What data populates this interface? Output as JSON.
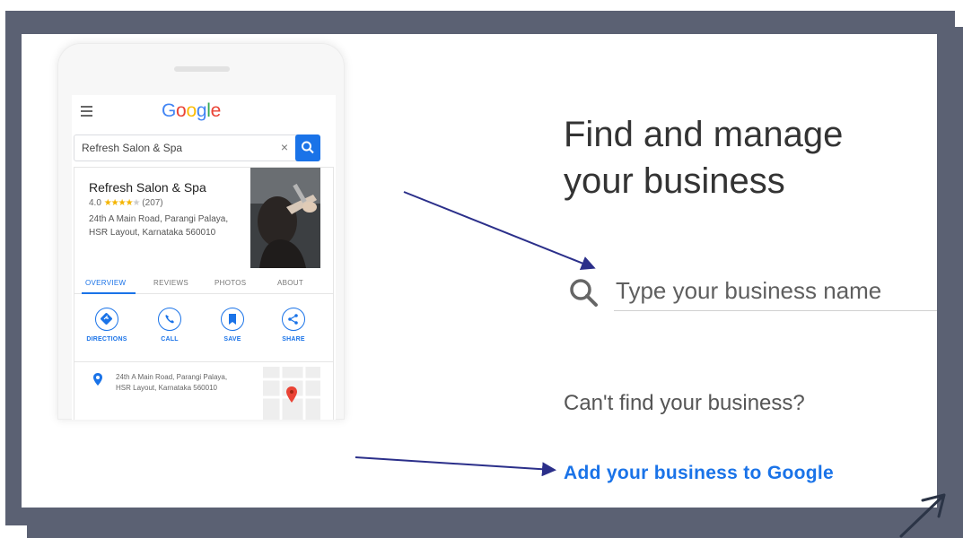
{
  "phone": {
    "google_logo": [
      {
        "ch": "G",
        "color": "#4285F4"
      },
      {
        "ch": "o",
        "color": "#EA4335"
      },
      {
        "ch": "o",
        "color": "#FBBC05"
      },
      {
        "ch": "g",
        "color": "#4285F4"
      },
      {
        "ch": "l",
        "color": "#34A853"
      },
      {
        "ch": "e",
        "color": "#EA4335"
      }
    ],
    "search_query": "Refresh Salon & Spa",
    "clear_glyph": "×",
    "business": {
      "name": "Refresh Salon & Spa",
      "rating": "4.0",
      "stars_filled": "★★★★",
      "stars_empty": "★",
      "reviews": "(207)",
      "address": "24th A Main Road, Parangi Palaya, HSR Layout, Karnataka 560010"
    },
    "tabs": [
      "OVERVIEW",
      "REVIEWS",
      "PHOTOS",
      "ABOUT"
    ],
    "actions": [
      "DIRECTIONS",
      "CALL",
      "SAVE",
      "SHARE"
    ],
    "address_row": "24th A Main Road, Parangi Palaya, HSR Layout, Karnataka 560010"
  },
  "main": {
    "headline": "Find and manage your business",
    "search_placeholder": "Type your business name",
    "cant_find": "Can't find your business?",
    "add_link": "Add your business to Google"
  },
  "colors": {
    "frame": "#5b6173",
    "accent": "#1a73e8",
    "arrow": "#2b2f8a"
  }
}
